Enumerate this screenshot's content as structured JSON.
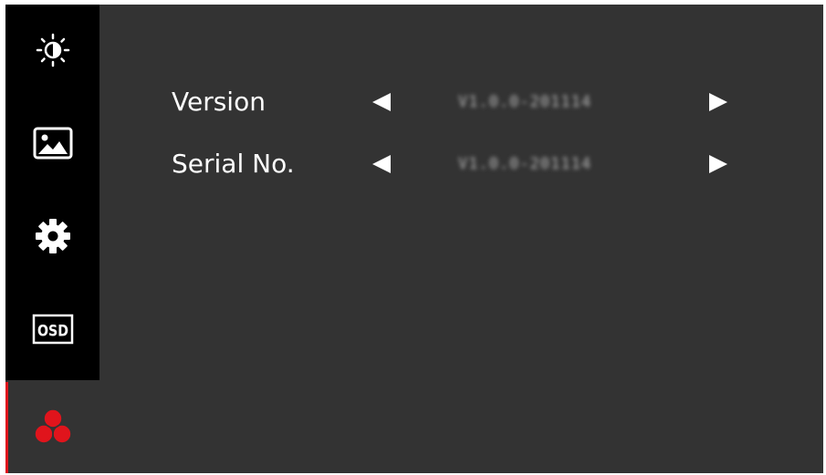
{
  "menu": {
    "sidebar": {
      "items": [
        {
          "icon": "brightness-icon"
        },
        {
          "icon": "picture-icon"
        },
        {
          "icon": "gear-icon"
        },
        {
          "icon": "osd-icon",
          "label": "OSD"
        },
        {
          "icon": "color-circles-icon",
          "active": true
        }
      ]
    },
    "rows": [
      {
        "label": "Version",
        "value": "V1.0.0-201114"
      },
      {
        "label": "Serial No.",
        "value": "V1.0.0-201114"
      }
    ]
  },
  "colors": {
    "background": "#333333",
    "sidebar": "#000000",
    "accent": "#e0141c",
    "text": "#ffffff"
  }
}
